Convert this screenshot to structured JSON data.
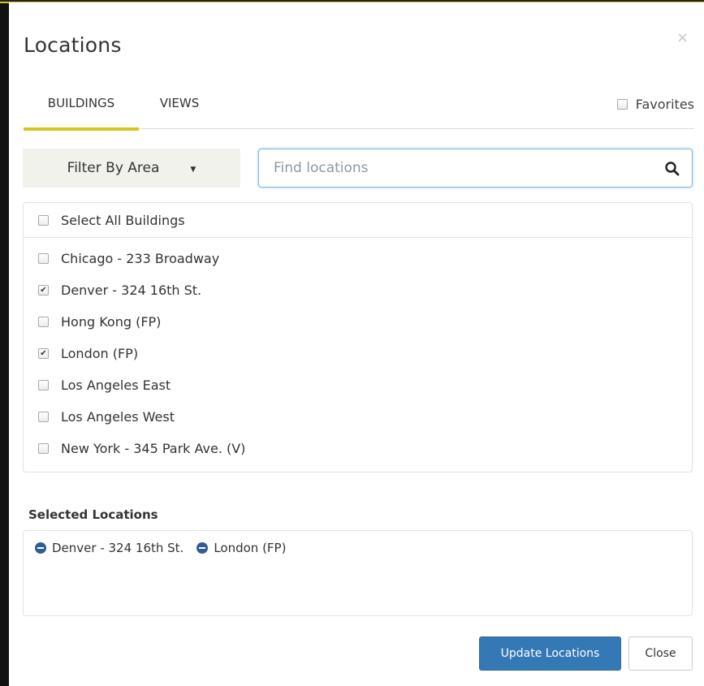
{
  "dialog": {
    "title": "Locations",
    "close_glyph": "×"
  },
  "tabs": [
    {
      "label": "BUILDINGS",
      "active": true
    },
    {
      "label": "VIEWS",
      "active": false
    }
  ],
  "favorites": {
    "label": "Favorites",
    "checked": false
  },
  "filter": {
    "label": "Filter By Area",
    "caret_glyph": "▼"
  },
  "search": {
    "placeholder": "Find locations",
    "value": "",
    "icon": "search-icon"
  },
  "select_all": {
    "label": "Select All Buildings",
    "checked": false
  },
  "buildings": [
    {
      "label": "Chicago - 233 Broadway",
      "checked": false
    },
    {
      "label": "Denver - 324 16th St.",
      "checked": true
    },
    {
      "label": "Hong Kong (FP)",
      "checked": false
    },
    {
      "label": "London (FP)",
      "checked": true
    },
    {
      "label": "Los Angeles East",
      "checked": false
    },
    {
      "label": "Los Angeles West",
      "checked": false
    },
    {
      "label": "New York - 345 Park Ave. (V)",
      "checked": false
    }
  ],
  "selected": {
    "title": "Selected Locations",
    "items": [
      "Denver - 324 16th St.",
      "London (FP)"
    ]
  },
  "footer": {
    "update_label": "Update Locations",
    "close_label": "Close"
  },
  "colors": {
    "accent_tab": "#d6c51c",
    "primary": "#3478b5",
    "remove_icon": "#2d5f96",
    "focus_border": "#7cb7e6"
  }
}
